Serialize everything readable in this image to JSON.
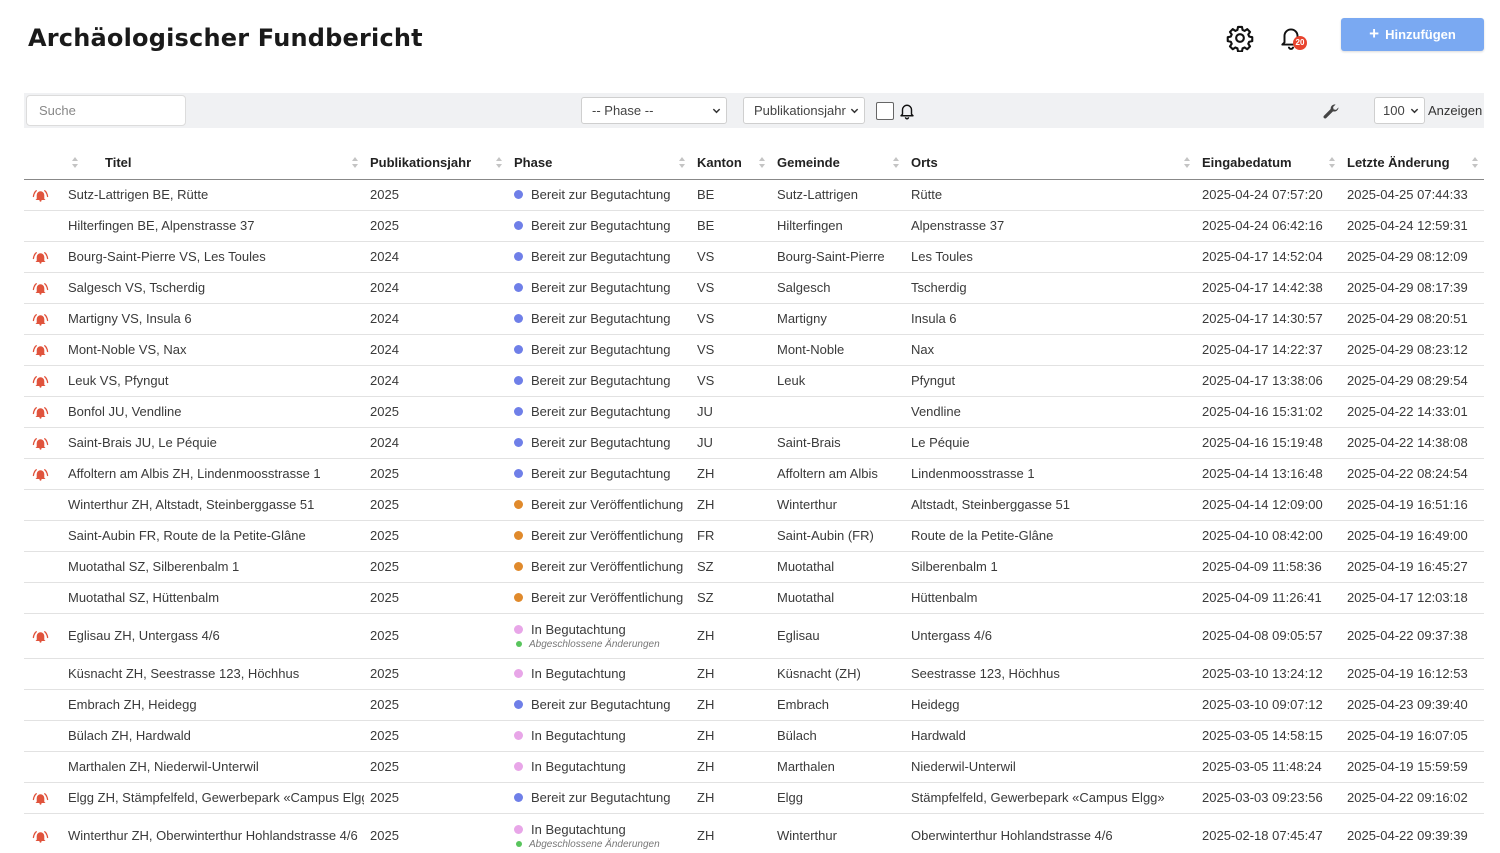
{
  "header": {
    "title": "Archäologischer Fundbericht",
    "notification_count": "20",
    "add_label": "Hinzufügen"
  },
  "icons": {
    "settings": "gear-icon",
    "notifications": "bell-icon",
    "add": "plus-icon",
    "filter_notifications": "bell-outline-icon",
    "tools": "wrench-icon",
    "row_alarm": "alarm-bell-icon",
    "sort": "sort-arrows-icon"
  },
  "toolbar": {
    "search_placeholder": "Suche",
    "phase_select": "-- Phase --",
    "pub_select": "Publikationsjahr",
    "page_size": "100",
    "show_label": "Anzeigen"
  },
  "colors": {
    "accent_button": "#7aa9f2",
    "badge": "#e8442e",
    "alarm": "#e0533c",
    "phase_review_ready": "#6f7fe8",
    "phase_publish_ready": "#e08a2c",
    "phase_in_review": "#e8a6e8",
    "sub_changes": "#58c45c"
  },
  "columns": [
    "",
    "Titel",
    "Publikationsjahr",
    "Phase",
    "Kanton",
    "Gemeinde",
    "Orts",
    "Eingabedatum",
    "Letzte Änderung"
  ],
  "phase_colors": {
    "Bereit zur Begutachtung": "#6f7fe8",
    "Bereit zur Veröffentlichung": "#e08a2c",
    "In Begutachtung": "#e8a6e8"
  },
  "rows": [
    {
      "alarm": true,
      "titel": "Sutz-Lattrigen BE, Rütte",
      "jahr": "2025",
      "phase": "Bereit zur Begutachtung",
      "sub": "",
      "kanton": "BE",
      "gemeinde": "Sutz-Lattrigen",
      "orts": "Rütte",
      "eingabe": "2025-04-24 07:57:20",
      "aenderung": "2025-04-25 07:44:33"
    },
    {
      "alarm": false,
      "titel": "Hilterfingen BE, Alpenstrasse 37",
      "jahr": "2025",
      "phase": "Bereit zur Begutachtung",
      "sub": "",
      "kanton": "BE",
      "gemeinde": "Hilterfingen",
      "orts": "Alpenstrasse 37",
      "eingabe": "2025-04-24 06:42:16",
      "aenderung": "2025-04-24 12:59:31"
    },
    {
      "alarm": true,
      "titel": "Bourg-Saint-Pierre VS, Les Toules",
      "jahr": "2024",
      "phase": "Bereit zur Begutachtung",
      "sub": "",
      "kanton": "VS",
      "gemeinde": "Bourg-Saint-Pierre",
      "orts": "Les Toules",
      "eingabe": "2025-04-17 14:52:04",
      "aenderung": "2025-04-29 08:12:09"
    },
    {
      "alarm": true,
      "titel": "Salgesch VS, Tscherdig",
      "jahr": "2024",
      "phase": "Bereit zur Begutachtung",
      "sub": "",
      "kanton": "VS",
      "gemeinde": "Salgesch",
      "orts": "Tscherdig",
      "eingabe": "2025-04-17 14:42:38",
      "aenderung": "2025-04-29 08:17:39"
    },
    {
      "alarm": true,
      "titel": "Martigny VS, Insula 6",
      "jahr": "2024",
      "phase": "Bereit zur Begutachtung",
      "sub": "",
      "kanton": "VS",
      "gemeinde": "Martigny",
      "orts": "Insula 6",
      "eingabe": "2025-04-17 14:30:57",
      "aenderung": "2025-04-29 08:20:51"
    },
    {
      "alarm": true,
      "titel": "Mont-Noble VS, Nax",
      "jahr": "2024",
      "phase": "Bereit zur Begutachtung",
      "sub": "",
      "kanton": "VS",
      "gemeinde": "Mont-Noble",
      "orts": "Nax",
      "eingabe": "2025-04-17 14:22:37",
      "aenderung": "2025-04-29 08:23:12"
    },
    {
      "alarm": true,
      "titel": "Leuk VS, Pfyngut",
      "jahr": "2024",
      "phase": "Bereit zur Begutachtung",
      "sub": "",
      "kanton": "VS",
      "gemeinde": "Leuk",
      "orts": "Pfyngut",
      "eingabe": "2025-04-17 13:38:06",
      "aenderung": "2025-04-29 08:29:54"
    },
    {
      "alarm": true,
      "titel": "Bonfol JU, Vendline",
      "jahr": "2025",
      "phase": "Bereit zur Begutachtung",
      "sub": "",
      "kanton": "JU",
      "gemeinde": "",
      "orts": "Vendline",
      "eingabe": "2025-04-16 15:31:02",
      "aenderung": "2025-04-22 14:33:01"
    },
    {
      "alarm": true,
      "titel": "Saint-Brais JU, Le Péquie",
      "jahr": "2024",
      "phase": "Bereit zur Begutachtung",
      "sub": "",
      "kanton": "JU",
      "gemeinde": "Saint-Brais",
      "orts": "Le Péquie",
      "eingabe": "2025-04-16 15:19:48",
      "aenderung": "2025-04-22 14:38:08"
    },
    {
      "alarm": true,
      "titel": "Affoltern am Albis ZH, Lindenmoosstrasse 1",
      "jahr": "2025",
      "phase": "Bereit zur Begutachtung",
      "sub": "",
      "kanton": "ZH",
      "gemeinde": "Affoltern am Albis",
      "orts": "Lindenmoosstrasse 1",
      "eingabe": "2025-04-14 13:16:48",
      "aenderung": "2025-04-22 08:24:54"
    },
    {
      "alarm": false,
      "titel": "Winterthur ZH, Altstadt, Steinberggasse 51",
      "jahr": "2025",
      "phase": "Bereit zur Veröffentlichung",
      "sub": "",
      "kanton": "ZH",
      "gemeinde": "Winterthur",
      "orts": "Altstadt, Steinberggasse 51",
      "eingabe": "2025-04-14 12:09:00",
      "aenderung": "2025-04-19 16:51:16"
    },
    {
      "alarm": false,
      "titel": "Saint-Aubin FR, Route de la Petite-Glâne",
      "jahr": "2025",
      "phase": "Bereit zur Veröffentlichung",
      "sub": "",
      "kanton": "FR",
      "gemeinde": "Saint-Aubin (FR)",
      "orts": "Route de la Petite-Glâne",
      "eingabe": "2025-04-10 08:42:00",
      "aenderung": "2025-04-19 16:49:00"
    },
    {
      "alarm": false,
      "titel": "Muotathal SZ, Silberenbalm 1",
      "jahr": "2025",
      "phase": "Bereit zur Veröffentlichung",
      "sub": "",
      "kanton": "SZ",
      "gemeinde": "Muotathal",
      "orts": "Silberenbalm 1",
      "eingabe": "2025-04-09 11:58:36",
      "aenderung": "2025-04-19 16:45:27"
    },
    {
      "alarm": false,
      "titel": "Muotathal SZ, Hüttenbalm",
      "jahr": "2025",
      "phase": "Bereit zur Veröffentlichung",
      "sub": "",
      "kanton": "SZ",
      "gemeinde": "Muotathal",
      "orts": "Hüttenbalm",
      "eingabe": "2025-04-09 11:26:41",
      "aenderung": "2025-04-17 12:03:18"
    },
    {
      "alarm": true,
      "titel": "Eglisau ZH, Untergass 4/6",
      "jahr": "2025",
      "phase": "In Begutachtung",
      "sub": "Abgeschlossene Änderungen",
      "kanton": "ZH",
      "gemeinde": "Eglisau",
      "orts": "Untergass 4/6",
      "eingabe": "2025-04-08 09:05:57",
      "aenderung": "2025-04-22 09:37:38"
    },
    {
      "alarm": false,
      "titel": "Küsnacht ZH, Seestrasse 123, Höchhus",
      "jahr": "2025",
      "phase": "In Begutachtung",
      "sub": "",
      "kanton": "ZH",
      "gemeinde": "Küsnacht (ZH)",
      "orts": "Seestrasse 123, Höchhus",
      "eingabe": "2025-03-10 13:24:12",
      "aenderung": "2025-04-19 16:12:53"
    },
    {
      "alarm": false,
      "titel": "Embrach ZH, Heidegg",
      "jahr": "2025",
      "phase": "Bereit zur Begutachtung",
      "sub": "",
      "kanton": "ZH",
      "gemeinde": "Embrach",
      "orts": "Heidegg",
      "eingabe": "2025-03-10 09:07:12",
      "aenderung": "2025-04-23 09:39:40"
    },
    {
      "alarm": false,
      "titel": "Bülach ZH, Hardwald",
      "jahr": "2025",
      "phase": "In Begutachtung",
      "sub": "",
      "kanton": "ZH",
      "gemeinde": "Bülach",
      "orts": "Hardwald",
      "eingabe": "2025-03-05 14:58:15",
      "aenderung": "2025-04-19 16:07:05"
    },
    {
      "alarm": false,
      "titel": "Marthalen ZH, Niederwil-Unterwil",
      "jahr": "2025",
      "phase": "In Begutachtung",
      "sub": "",
      "kanton": "ZH",
      "gemeinde": "Marthalen",
      "orts": "Niederwil-Unterwil",
      "eingabe": "2025-03-05 11:48:24",
      "aenderung": "2025-04-19 15:59:59"
    },
    {
      "alarm": true,
      "titel": "Elgg ZH, Stämpfelfeld, Gewerbepark «Campus Elgg»",
      "jahr": "2025",
      "phase": "Bereit zur Begutachtung",
      "sub": "",
      "kanton": "ZH",
      "gemeinde": "Elgg",
      "orts": "Stämpfelfeld, Gewerbepark «Campus Elgg»",
      "eingabe": "2025-03-03 09:23:56",
      "aenderung": "2025-04-22 09:16:02"
    },
    {
      "alarm": true,
      "titel": "Winterthur ZH, Oberwinterthur Hohlandstrasse 4/6",
      "jahr": "2025",
      "phase": "In Begutachtung",
      "sub": "Abgeschlossene Änderungen",
      "kanton": "ZH",
      "gemeinde": "Winterthur",
      "orts": "Oberwinterthur Hohlandstrasse 4/6",
      "eingabe": "2025-02-18 07:45:47",
      "aenderung": "2025-04-22 09:39:39"
    }
  ]
}
